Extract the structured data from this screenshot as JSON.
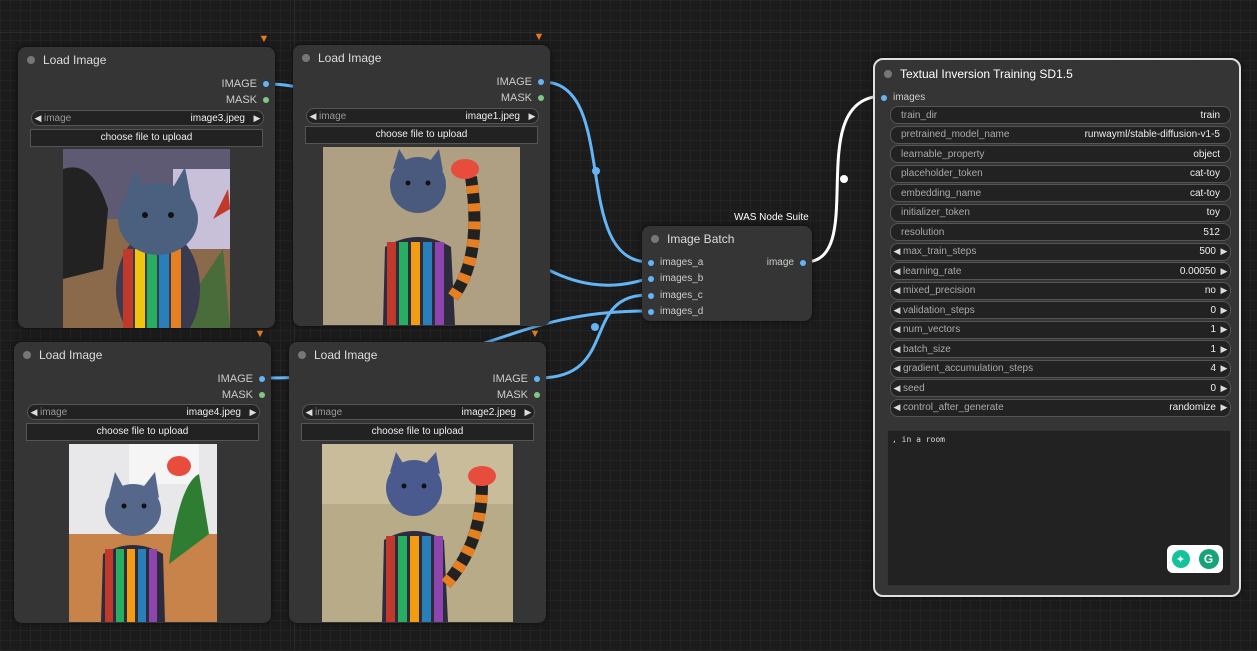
{
  "canvas": {
    "background": "#1b1b1b",
    "link_color": "#64b5f6",
    "mask_color": "#81c784"
  },
  "load_nodes": [
    {
      "title": "Load Image",
      "out_image": "IMAGE",
      "out_mask": "MASK",
      "widget_label": "image",
      "widget_value": "image3.jpeg",
      "upload_label": "choose file to upload",
      "badge": "fox-badge-icon"
    },
    {
      "title": "Load Image",
      "out_image": "IMAGE",
      "out_mask": "MASK",
      "widget_label": "image",
      "widget_value": "image1.jpeg",
      "upload_label": "choose file to upload",
      "badge": "fox-badge-icon"
    },
    {
      "title": "Load Image",
      "out_image": "IMAGE",
      "out_mask": "MASK",
      "widget_label": "image",
      "widget_value": "image4.jpeg",
      "upload_label": "choose file to upload",
      "badge": "fox-badge-icon"
    },
    {
      "title": "Load Image",
      "out_image": "IMAGE",
      "out_mask": "MASK",
      "widget_label": "image",
      "widget_value": "image2.jpeg",
      "upload_label": "choose file to upload",
      "badge": "fox-badge-icon"
    }
  ],
  "batch_node": {
    "title": "Image Batch",
    "suite_label": "WAS Node Suite",
    "inputs": [
      "images_a",
      "images_b",
      "images_c",
      "images_d"
    ],
    "output": "image"
  },
  "train_node": {
    "title": "Textual Inversion Training SD1.5",
    "input": "images",
    "fields": [
      {
        "label": "train_dir",
        "value": "train",
        "kind": "text"
      },
      {
        "label": "pretrained_model_name",
        "value": "runwayml/stable-diffusion-v1-5",
        "kind": "text"
      },
      {
        "label": "learnable_property",
        "value": "object",
        "kind": "text"
      },
      {
        "label": "placeholder_token",
        "value": "cat-toy",
        "kind": "text"
      },
      {
        "label": "embedding_name",
        "value": "cat-toy",
        "kind": "text"
      },
      {
        "label": "initializer_token",
        "value": "toy",
        "kind": "text"
      },
      {
        "label": "resolution",
        "value": "512",
        "kind": "text"
      },
      {
        "label": "max_train_steps",
        "value": "500",
        "kind": "num"
      },
      {
        "label": "learning_rate",
        "value": "0.00050",
        "kind": "num"
      },
      {
        "label": "mixed_precision",
        "value": "no",
        "kind": "num"
      },
      {
        "label": "validation_steps",
        "value": "0",
        "kind": "num"
      },
      {
        "label": "num_vectors",
        "value": "1",
        "kind": "num"
      },
      {
        "label": "batch_size",
        "value": "1",
        "kind": "num"
      },
      {
        "label": "gradient_accumulation_steps",
        "value": "4",
        "kind": "num"
      },
      {
        "label": "seed",
        "value": "0",
        "kind": "num"
      },
      {
        "label": "control_after_generate",
        "value": "randomize",
        "kind": "num"
      }
    ],
    "prompt_text": ", in a room",
    "assistant_icons": [
      "lightbulb-icon",
      "grammarly-icon"
    ]
  }
}
